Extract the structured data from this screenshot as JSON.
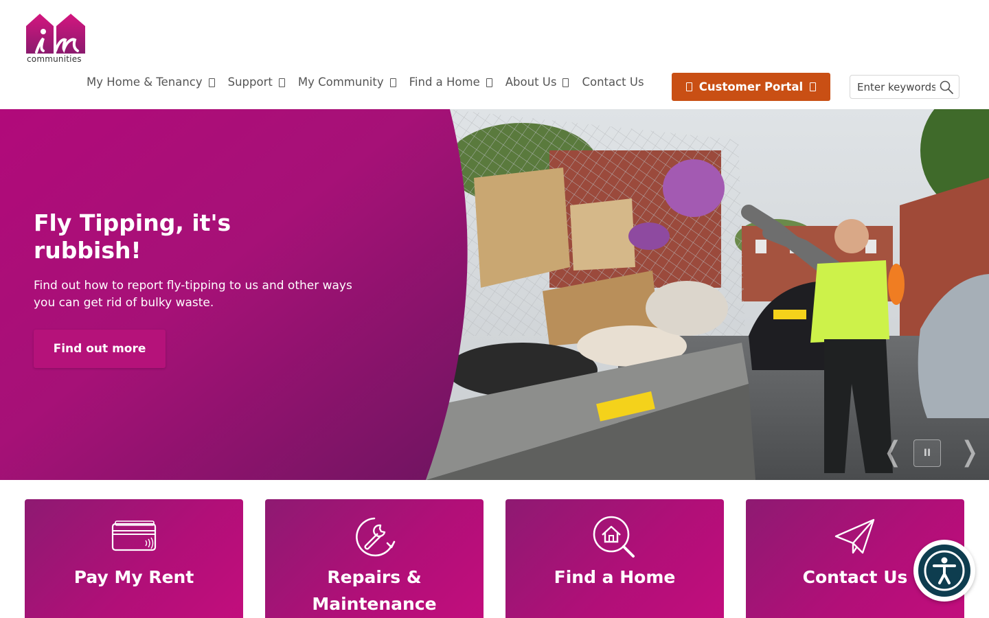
{
  "brand": {
    "logo_text": "communities",
    "accent": "#b5127a",
    "portal_color": "#c94f14"
  },
  "nav": {
    "items": [
      {
        "label": "My Home & Tenancy",
        "has_dropdown": true
      },
      {
        "label": "Support",
        "has_dropdown": true
      },
      {
        "label": "My Community",
        "has_dropdown": true
      },
      {
        "label": "Find a Home",
        "has_dropdown": true
      },
      {
        "label": "About Us",
        "has_dropdown": true
      },
      {
        "label": "Contact Us",
        "has_dropdown": false
      }
    ],
    "portal_label": "Customer Portal",
    "search_placeholder": "Enter keywords"
  },
  "hero": {
    "title": "Fly Tipping, it's rubbish!",
    "subtitle": "Find out how to report fly-tipping to us and other ways you can get rid of bulky waste.",
    "button_label": "Find out more",
    "prev_glyph": "❬",
    "next_glyph": "❭",
    "pause_glyph": "II"
  },
  "cards": [
    {
      "label": "Pay My Rent",
      "icon": "credit-card-icon"
    },
    {
      "label": "Repairs & Maintenance",
      "icon": "wrench-icon"
    },
    {
      "label": "Find a Home",
      "icon": "house-search-icon"
    },
    {
      "label": "Contact Us",
      "icon": "paper-plane-icon"
    }
  ]
}
